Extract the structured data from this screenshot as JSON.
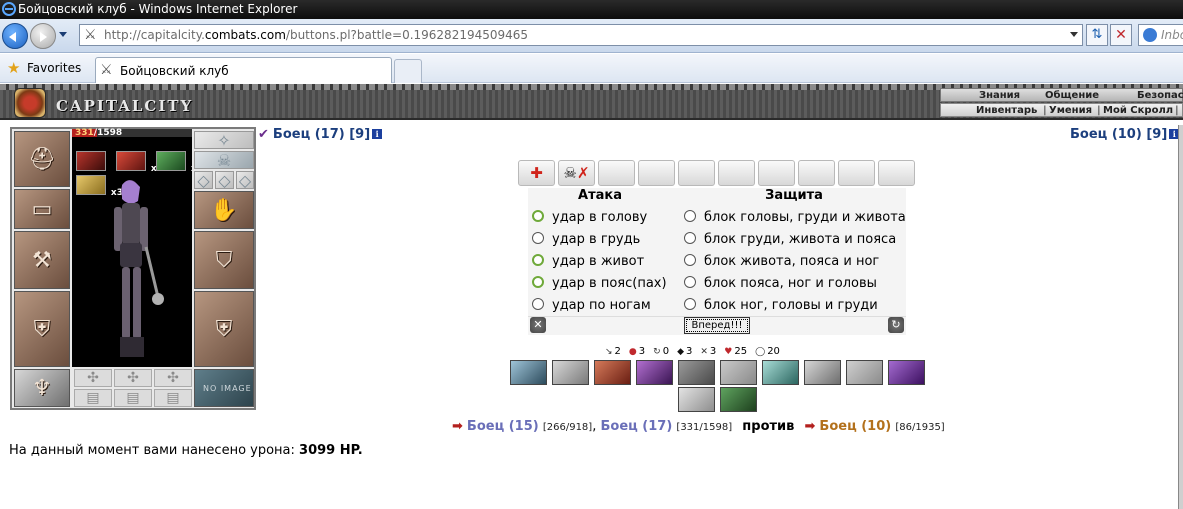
{
  "window": {
    "title": "Бойцовский клуб - Windows Internet Explorer",
    "url_prefix": "http://capitalcity.",
    "url_host": "combats.com",
    "url_suffix": "/buttons.pl?battle=0.196282194509465",
    "search_placeholder": "Inbo"
  },
  "favorites": {
    "label": "Favorites"
  },
  "tab": {
    "label": "Бойцовский клуб"
  },
  "game": {
    "logo": "CAPITALCITY",
    "menu_top": [
      "Знания",
      "Общение",
      "Безопас"
    ],
    "menu_bottom": [
      "Инвентарь",
      "Умения",
      "Мой Скролл"
    ]
  },
  "character": {
    "hp_current": "331",
    "hp_max": "/1598",
    "hp_fraction": 0.207,
    "effects": [
      {
        "multiplier": ""
      },
      {
        "multiplier": "x3"
      },
      {
        "multiplier": "x3"
      },
      {
        "multiplier": "x3"
      }
    ],
    "no_image_label": "NO IMAGE"
  },
  "players": {
    "left": {
      "name": "Боец (17)",
      "level": "[9]"
    },
    "right": {
      "name": "Боец (10)",
      "level": "[9]"
    }
  },
  "form": {
    "attack_header": "Атака",
    "defense_header": "Защита",
    "attacks": [
      {
        "label": "удар в голову",
        "highlighted": true
      },
      {
        "label": "удар в грудь",
        "highlighted": false
      },
      {
        "label": "удар в живот",
        "highlighted": true
      },
      {
        "label": "удар в пояс(пах)",
        "highlighted": true
      },
      {
        "label": "удар по ногам",
        "highlighted": false
      }
    ],
    "defenses": [
      "блок головы, груди и живота",
      "блок груди, живота и пояса",
      "блок живота, пояса и ног",
      "блок пояса, ног и головы",
      "блок ног, головы и груди"
    ],
    "submit_label": "Вперед!!!"
  },
  "stats": [
    {
      "icon": "↘",
      "value": "2"
    },
    {
      "icon": "●",
      "value": "3"
    },
    {
      "icon": "↻",
      "value": "0"
    },
    {
      "icon": "◆",
      "value": "3"
    },
    {
      "icon": "✕",
      "value": "3"
    },
    {
      "icon": "♥",
      "value": "25"
    },
    {
      "icon": "◯",
      "value": "20"
    }
  ],
  "battle": {
    "team1": [
      {
        "name": "Боец (15)",
        "hp": "[266/918]"
      },
      {
        "name": "Боец (17)",
        "hp": "[331/1598]"
      }
    ],
    "separator": ",",
    "vs": "против",
    "team2": [
      {
        "name": "Боец (10)",
        "hp": "[86/1935]"
      }
    ]
  },
  "damage": {
    "text": "На данный момент вами нанесено урона:",
    "value": "3099 HP."
  },
  "colors": {
    "ally": "#6a6fb8",
    "enemy": "#b3711c",
    "player_name": "#1c3f7e",
    "hp_bar": "#b5201e"
  }
}
